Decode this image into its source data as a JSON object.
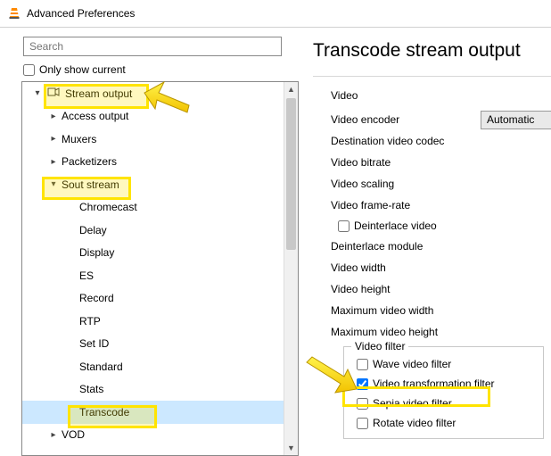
{
  "window": {
    "title": "Advanced Preferences"
  },
  "search": {
    "placeholder": "Search"
  },
  "only_current": {
    "label": "Only show current"
  },
  "tree": {
    "stream_output": "Stream output",
    "access_output": "Access output",
    "muxers": "Muxers",
    "packetizers": "Packetizers",
    "sout_stream": "Sout stream",
    "chromecast": "Chromecast",
    "delay": "Delay",
    "display": "Display",
    "es": "ES",
    "record": "Record",
    "rtp": "RTP",
    "set_id": "Set ID",
    "standard": "Standard",
    "stats": "Stats",
    "transcode": "Transcode",
    "vod": "VOD"
  },
  "right": {
    "title": "Transcode stream output",
    "video_group": "Video",
    "video_encoder": "Video encoder",
    "video_encoder_value": "Automatic",
    "dest_codec": "Destination video codec",
    "bitrate": "Video bitrate",
    "scaling": "Video scaling",
    "framerate": "Video frame-rate",
    "deinterlace": "Deinterlace video",
    "deint_module": "Deinterlace module",
    "width": "Video width",
    "height": "Video height",
    "max_width": "Maximum video width",
    "max_height": "Maximum video height",
    "filter_group": "Video filter",
    "filter_wave": "Wave video filter",
    "filter_transform": "Video transformation filter",
    "filter_sepia": "Sepia video filter",
    "filter_rotate": "Rotate video filter"
  }
}
